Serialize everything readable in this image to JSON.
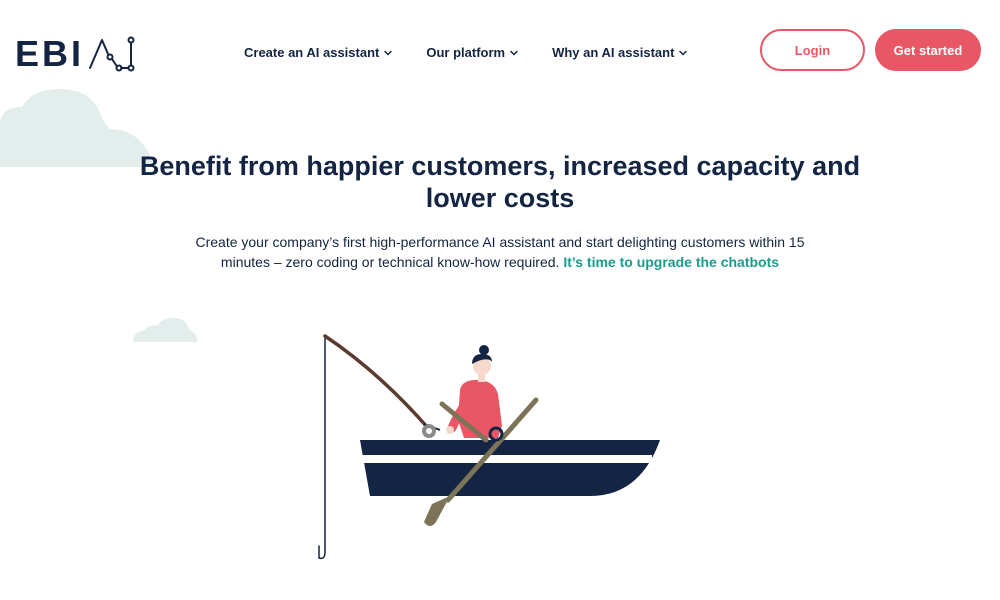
{
  "logo": {
    "text": "EBI",
    "icon": "ai-circuit-logo-mark"
  },
  "nav": {
    "items": [
      {
        "label": "Create an AI assistant",
        "icon": "chevron-down-icon"
      },
      {
        "label": "Our platform",
        "icon": "chevron-down-icon"
      },
      {
        "label": "Why an AI assistant",
        "icon": "chevron-down-icon"
      }
    ]
  },
  "header": {
    "login_label": "Login",
    "get_started_label": "Get started"
  },
  "hero": {
    "headline": "Benefit from happier customers, increased capacity and lower costs",
    "subtext": "Create your company’s first high-performance AI assistant and start delighting customers within 15 minutes – zero coding or technical know-how required. ",
    "link_text": "It’s time to upgrade the chatbots",
    "illustration": "woman-fishing-in-rowboat-illustration"
  },
  "colors": {
    "navy": "#132542",
    "coral": "#e95766",
    "teal_link": "#1a9c8c",
    "cloud": "#e3edeb",
    "oar": "#7c7358"
  }
}
